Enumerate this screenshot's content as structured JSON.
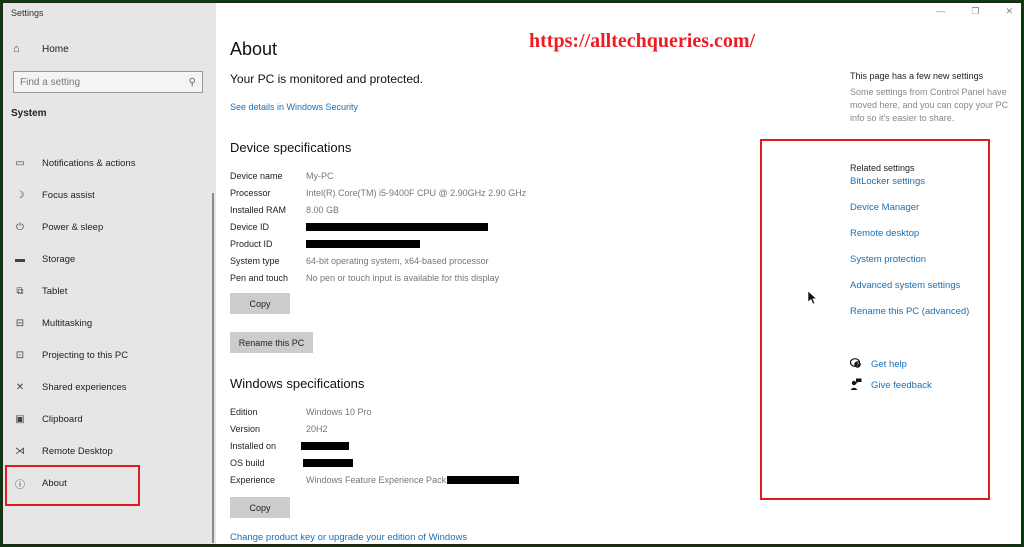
{
  "window": {
    "title": "Settings",
    "controls": {
      "minimize": "—",
      "maximize": "❐",
      "close": "✕"
    }
  },
  "sidebar": {
    "home_label": "Home",
    "home_icon": "⌂",
    "search_placeholder": "Find a setting",
    "search_icon": "⚲",
    "section": "System",
    "items": [
      {
        "label": "Notifications & actions",
        "icon": "▭"
      },
      {
        "label": "Focus assist",
        "icon": "☽"
      },
      {
        "label": "Power & sleep",
        "icon": "⏻"
      },
      {
        "label": "Storage",
        "icon": "▬"
      },
      {
        "label": "Tablet",
        "icon": "⧉"
      },
      {
        "label": "Multitasking",
        "icon": "⊟"
      },
      {
        "label": "Projecting to this PC",
        "icon": "⊡"
      },
      {
        "label": "Shared experiences",
        "icon": "✕"
      },
      {
        "label": "Clipboard",
        "icon": "▣"
      },
      {
        "label": "Remote Desktop",
        "icon": "⋊"
      },
      {
        "label": "About",
        "icon": "ⓘ"
      }
    ]
  },
  "watermark": "https://alltechqueries.com/",
  "main": {
    "title": "About",
    "protection_status": "Your PC is monitored and protected.",
    "security_link": "See details in Windows Security",
    "device_specs": {
      "heading": "Device specifications",
      "rows": [
        {
          "label": "Device name",
          "value": "My-PC"
        },
        {
          "label": "Processor",
          "value": "Intel(R) Core(TM) i5-9400F CPU @ 2.90GHz   2.90 GHz"
        },
        {
          "label": "Installed RAM",
          "value": "8.00 GB"
        },
        {
          "label": "Device ID",
          "value": ""
        },
        {
          "label": "Product ID",
          "value": ""
        },
        {
          "label": "System type",
          "value": "64-bit operating system, x64-based processor"
        },
        {
          "label": "Pen and touch",
          "value": "No pen or touch input is available for this display"
        }
      ],
      "copy_button": "Copy",
      "rename_button": "Rename this PC"
    },
    "windows_specs": {
      "heading": "Windows specifications",
      "rows": [
        {
          "label": "Edition",
          "value": "Windows 10 Pro"
        },
        {
          "label": "Version",
          "value": "20H2"
        },
        {
          "label": "Installed on",
          "value": ""
        },
        {
          "label": "OS build",
          "value": ""
        },
        {
          "label": "Experience",
          "value": "Windows Feature Experience Pack"
        }
      ],
      "copy_button": "Copy"
    },
    "upgrade_link": "Change product key or upgrade your edition of Windows"
  },
  "right_panel": {
    "info_title": "This page has a few new settings",
    "info_desc": "Some settings from Control Panel have moved here, and you can copy your PC info so it's easier to share.",
    "related_title": "Related settings",
    "related_links": [
      "BitLocker settings",
      "Device Manager",
      "Remote desktop",
      "System protection",
      "Advanced system settings",
      "Rename this PC (advanced)"
    ],
    "get_help": "Get help",
    "give_feedback": "Give feedback"
  },
  "colors": {
    "link": "#1a6fb5",
    "highlight": "#e01b24",
    "watermark": "#ee1c25",
    "sidebar_bg": "#e6e6e6"
  }
}
